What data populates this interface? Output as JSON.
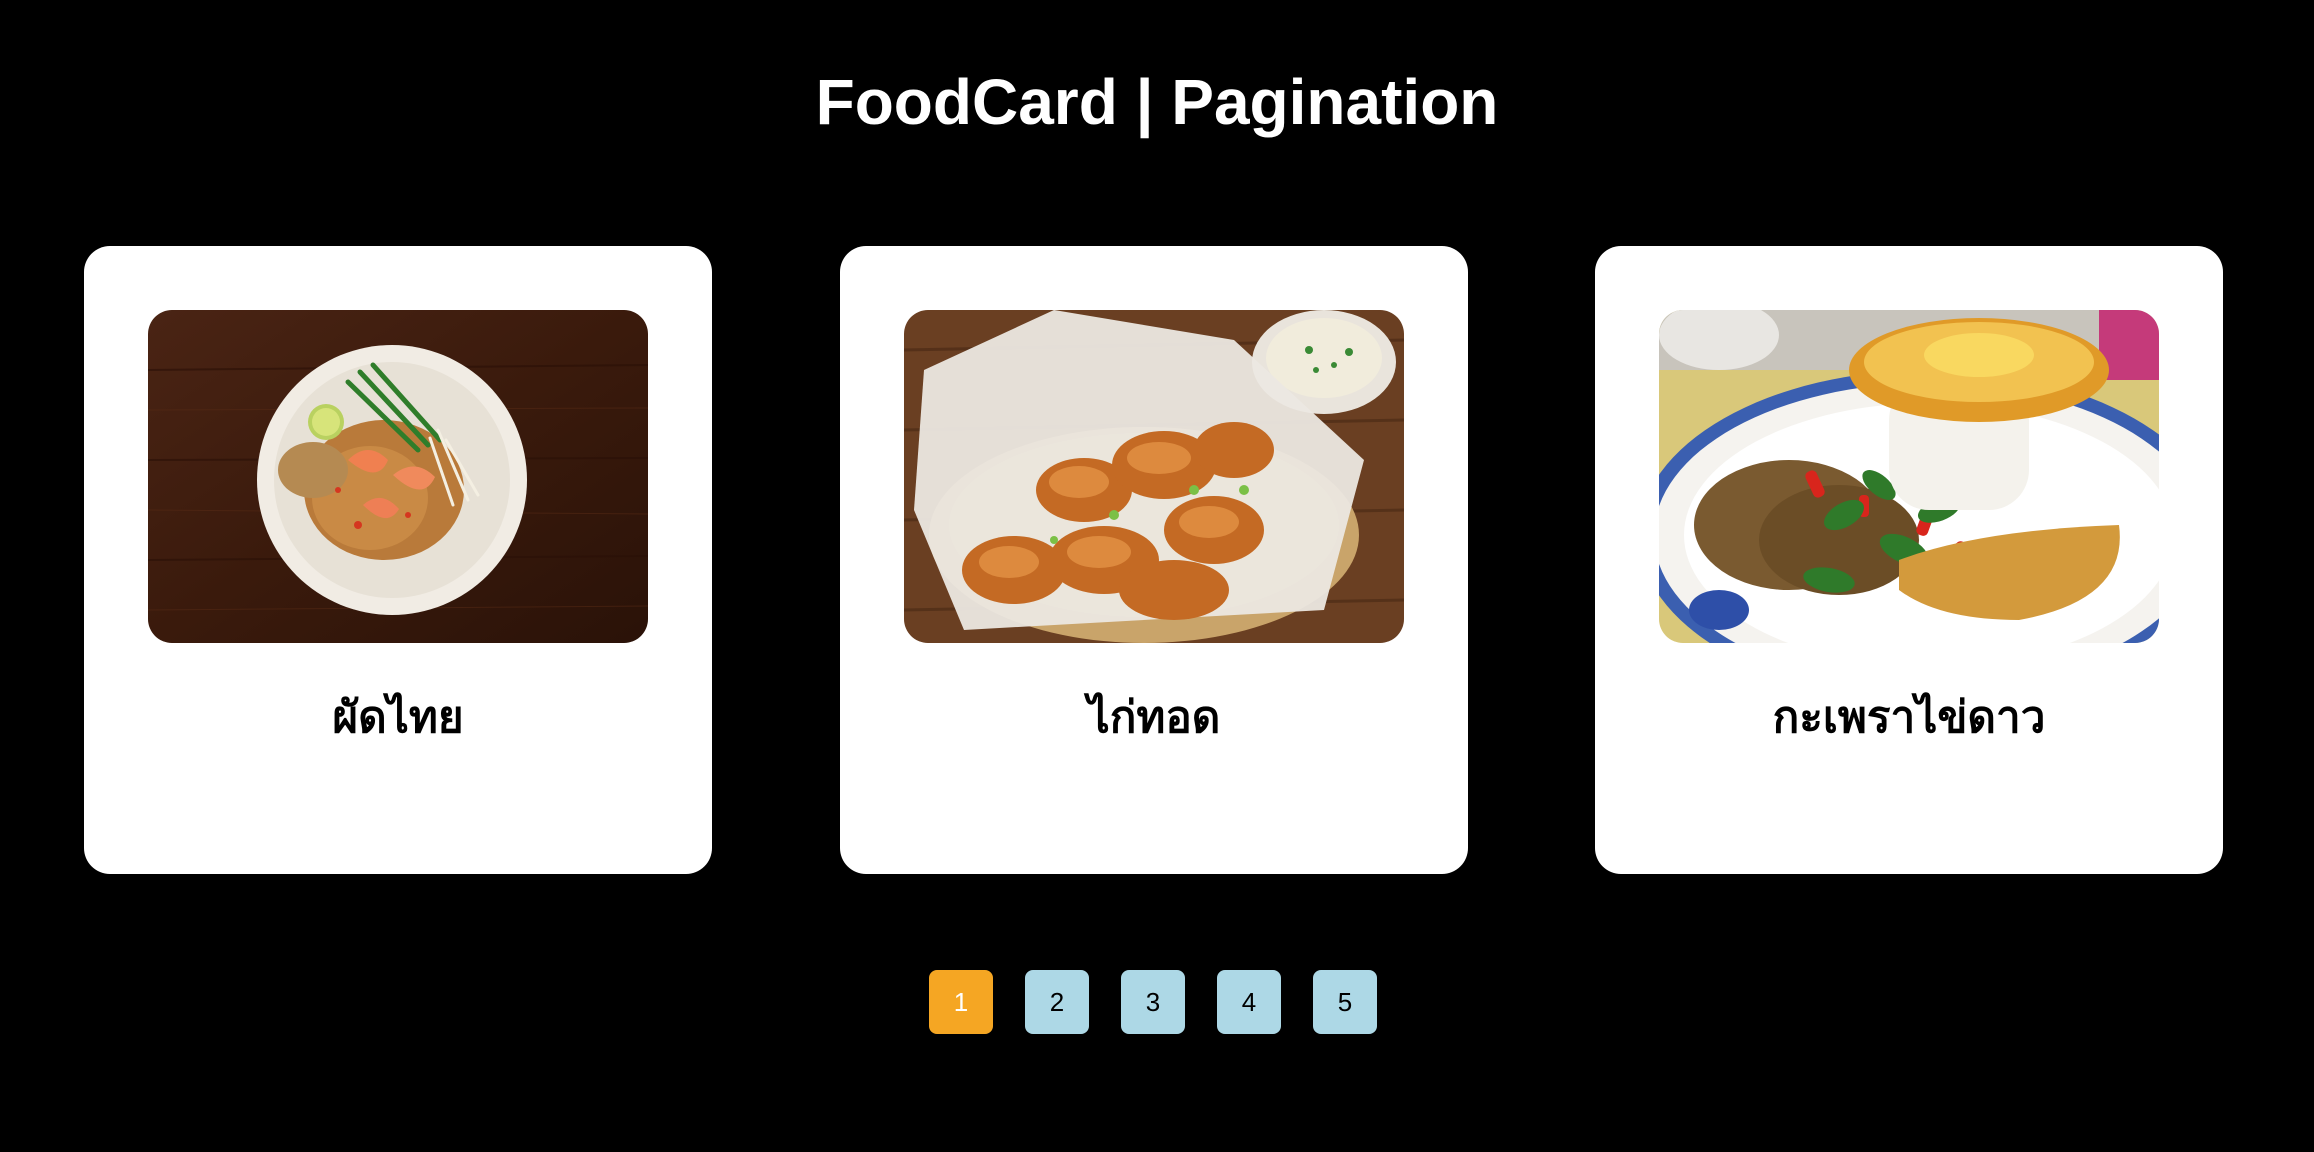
{
  "header": {
    "title": "FoodCard | Pagination"
  },
  "cards": [
    {
      "name": "ผัดไทย",
      "image": "pad-thai-photo"
    },
    {
      "name": "ไก่ทอด",
      "image": "fried-chicken-photo"
    },
    {
      "name": "กะเพราไข่ดาว",
      "image": "basil-pork-fried-egg-photo"
    }
  ],
  "pagination": {
    "pages": [
      "1",
      "2",
      "3",
      "4",
      "5"
    ],
    "current": "1"
  },
  "colors": {
    "background": "#000000",
    "card": "#ffffff",
    "active_page": "#f5a623",
    "page_button": "#add8e6"
  }
}
